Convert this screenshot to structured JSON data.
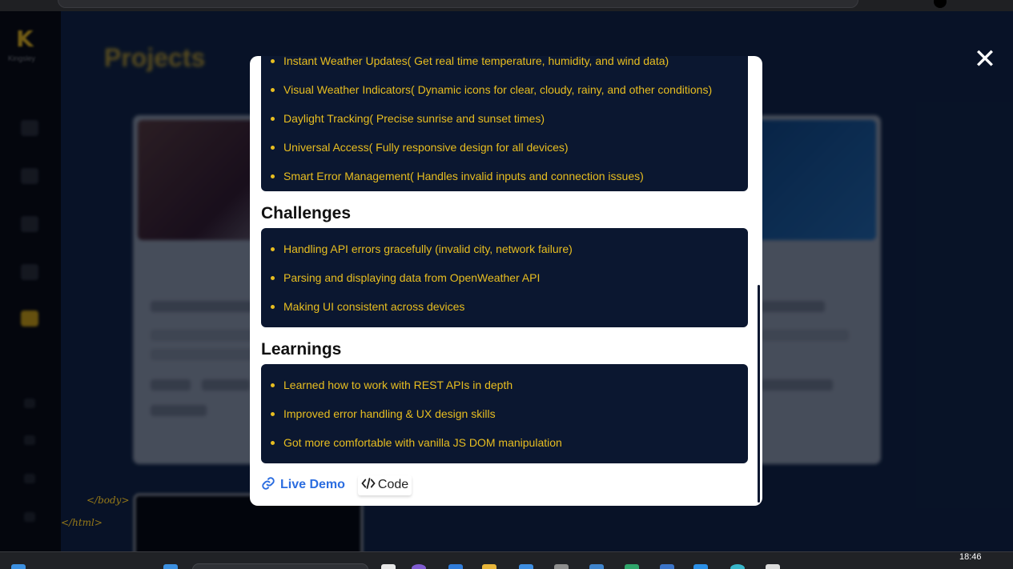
{
  "page": {
    "logo_letter": "K",
    "logo_sub": "Kingsley",
    "projects_title": "Projects",
    "close_icon": "✕",
    "body_close_tag": "</body>",
    "html_close_tag": "</html>"
  },
  "modal": {
    "features": [
      "Instant Weather Updates( Get real time temperature, humidity, and wind data)",
      "Visual Weather Indicators( Dynamic icons for clear, cloudy, rainy, and other conditions)",
      "Daylight Tracking( Precise sunrise and sunset times)",
      "Universal Access( Fully responsive design for all devices)",
      "Smart Error Management( Handles invalid inputs and connection issues)"
    ],
    "challenges_heading": "Challenges",
    "challenges": [
      "Handling API errors gracefully (invalid city, network failure)",
      "Parsing and displaying data from OpenWeather API",
      "Making UI consistent across devices"
    ],
    "learnings_heading": "Learnings",
    "learnings": [
      "Learned how to work with REST APIs in depth",
      "Improved error handling & UX design skills",
      "Got more comfortable with vanilla JS DOM manipulation"
    ],
    "live_demo_label": "Live Demo",
    "code_label": "Code"
  },
  "taskbar": {
    "clock_time": "18:46"
  },
  "colors": {
    "accent_yellow": "#e8be20",
    "navy": "#0b1730",
    "link_blue": "#2b6de0"
  }
}
